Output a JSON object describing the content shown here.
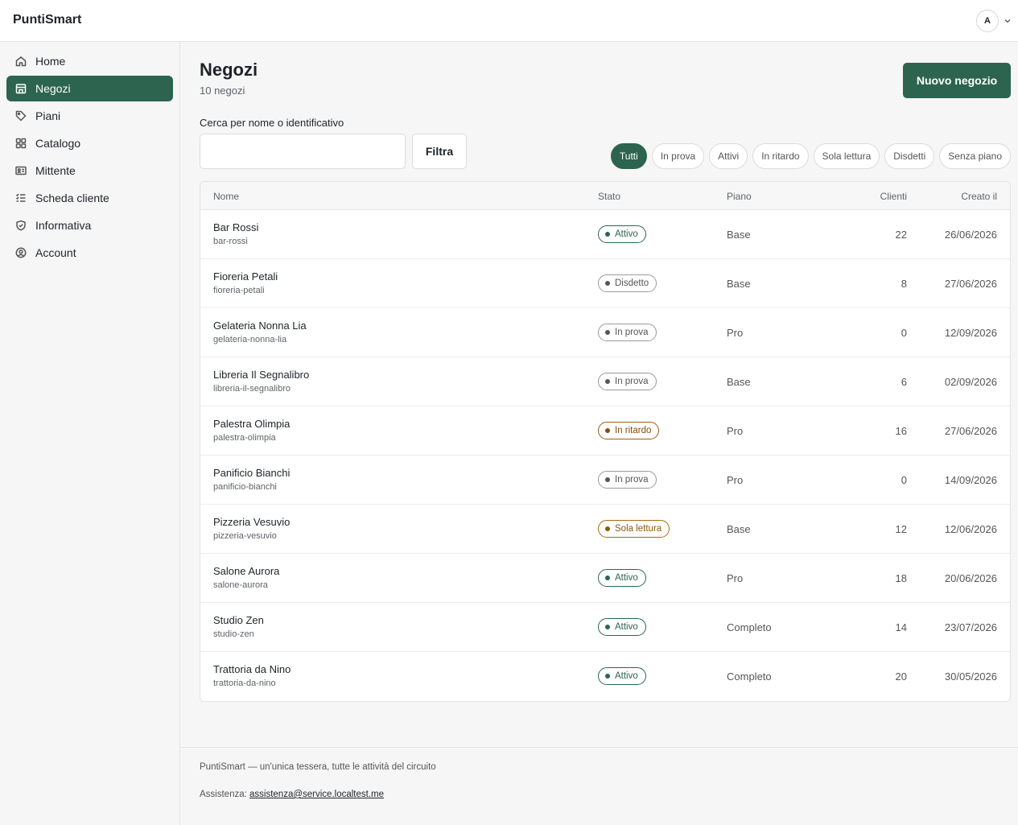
{
  "app": {
    "brand": "PuntiSmart",
    "avatar_initial": "A"
  },
  "sidebar": {
    "items": [
      {
        "label": "Home",
        "icon": "home-icon",
        "active": false
      },
      {
        "label": "Negozi",
        "icon": "store-icon",
        "active": true
      },
      {
        "label": "Piani",
        "icon": "tag-icon",
        "active": false
      },
      {
        "label": "Catalogo",
        "icon": "grid-icon",
        "active": false
      },
      {
        "label": "Mittente",
        "icon": "id-card-icon",
        "active": false
      },
      {
        "label": "Scheda cliente",
        "icon": "checklist-icon",
        "active": false
      },
      {
        "label": "Informativa",
        "icon": "shield-icon",
        "active": false
      },
      {
        "label": "Account",
        "icon": "user-circle-icon",
        "active": false
      }
    ]
  },
  "header": {
    "title": "Negozi",
    "subtitle": "10 negozi",
    "new_button": "Nuovo negozio"
  },
  "search": {
    "label": "Cerca per nome o identificativo",
    "value": "",
    "placeholder": "",
    "filter_button": "Filtra"
  },
  "filters": [
    {
      "label": "Tutti",
      "active": true
    },
    {
      "label": "In prova",
      "active": false
    },
    {
      "label": "Attivi",
      "active": false
    },
    {
      "label": "In ritardo",
      "active": false
    },
    {
      "label": "Sola lettura",
      "active": false
    },
    {
      "label": "Disdetti",
      "active": false
    },
    {
      "label": "Senza piano",
      "active": false
    }
  ],
  "table": {
    "columns": {
      "nome": "Nome",
      "stato": "Stato",
      "piano": "Piano",
      "clienti": "Clienti",
      "creato": "Creato il"
    },
    "rows": [
      {
        "name": "Bar Rossi",
        "slug": "bar-rossi",
        "status": "Attivo",
        "tone": "green",
        "plan": "Base",
        "clients": "22",
        "created": "26/06/2026"
      },
      {
        "name": "Fioreria Petali",
        "slug": "fioreria-petali",
        "status": "Disdetto",
        "tone": "gray",
        "plan": "Base",
        "clients": "8",
        "created": "27/06/2026"
      },
      {
        "name": "Gelateria Nonna Lia",
        "slug": "gelateria-nonna-lia",
        "status": "In prova",
        "tone": "gray",
        "plan": "Pro",
        "clients": "0",
        "created": "12/09/2026"
      },
      {
        "name": "Libreria Il Segnalibro",
        "slug": "libreria-il-segnalibro",
        "status": "In prova",
        "tone": "gray",
        "plan": "Base",
        "clients": "6",
        "created": "02/09/2026"
      },
      {
        "name": "Palestra Olimpia",
        "slug": "palestra-olimpia",
        "status": "In ritardo",
        "tone": "orange",
        "plan": "Pro",
        "clients": "16",
        "created": "27/06/2026"
      },
      {
        "name": "Panificio Bianchi",
        "slug": "panificio-bianchi",
        "status": "In prova",
        "tone": "gray",
        "plan": "Pro",
        "clients": "0",
        "created": "14/09/2026"
      },
      {
        "name": "Pizzeria Vesuvio",
        "slug": "pizzeria-vesuvio",
        "status": "Sola lettura",
        "tone": "gold",
        "plan": "Base",
        "clients": "12",
        "created": "12/06/2026"
      },
      {
        "name": "Salone Aurora",
        "slug": "salone-aurora",
        "status": "Attivo",
        "tone": "green",
        "plan": "Pro",
        "clients": "18",
        "created": "20/06/2026"
      },
      {
        "name": "Studio Zen",
        "slug": "studio-zen",
        "status": "Attivo",
        "tone": "green",
        "plan": "Completo",
        "clients": "14",
        "created": "23/07/2026"
      },
      {
        "name": "Trattoria da Nino",
        "slug": "trattoria-da-nino",
        "status": "Attivo",
        "tone": "green",
        "plan": "Completo",
        "clients": "20",
        "created": "30/05/2026"
      }
    ]
  },
  "footer": {
    "tagline": "PuntiSmart — un'unica tessera, tutte le attività del circuito",
    "support_label": "Assistenza:",
    "support_email": "assistenza@service.localtest.me"
  },
  "colors": {
    "accent": "#2c6450",
    "late": "#a05a12",
    "readonly": "#a86b0c"
  }
}
